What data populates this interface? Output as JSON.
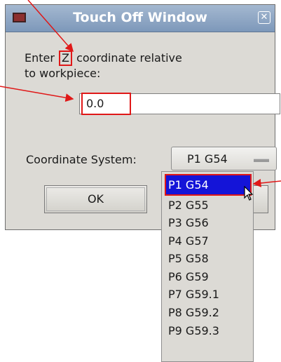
{
  "window": {
    "title": "Touch Off Window",
    "close_glyph": "✕"
  },
  "prompt": {
    "before": "Enter ",
    "axis": "Z",
    "after": " coordinate relative",
    "line2": "to workpiece:"
  },
  "coordinate_input": {
    "value": "0.0"
  },
  "coordinate_system": {
    "label": "Coordinate System:",
    "selected": "P1 G54",
    "options": [
      "P1 G54",
      "P2 G55",
      "P3 G56",
      "P4 G57",
      "P5 G58",
      "P6 G59",
      "P7 G59.1",
      "P8 G59.2",
      "P9 G59.3"
    ]
  },
  "buttons": {
    "ok": "OK"
  },
  "colors": {
    "annotation": "#e01818",
    "selection": "#1414d8"
  }
}
